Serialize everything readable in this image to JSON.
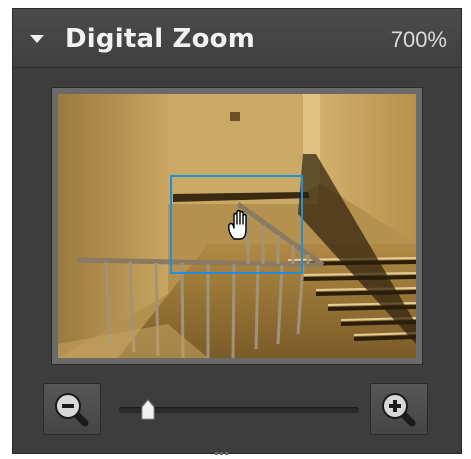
{
  "panel": {
    "title": "Digital Zoom",
    "zoom_level": "700%",
    "collapse_icon": "triangle-down-icon"
  },
  "preview": {
    "image_description_icon": "stairwell-camera-image",
    "selection_cursor_icon": "hand-icon"
  },
  "controls": {
    "zoom_out_icon": "magnifier-minus-icon",
    "zoom_in_icon": "magnifier-plus-icon",
    "slider_value": 0.07
  },
  "colors": {
    "panel_bg": "#3d3d3d",
    "selection_border": "#1f8fd8",
    "title_text": "#f2f2f2"
  }
}
